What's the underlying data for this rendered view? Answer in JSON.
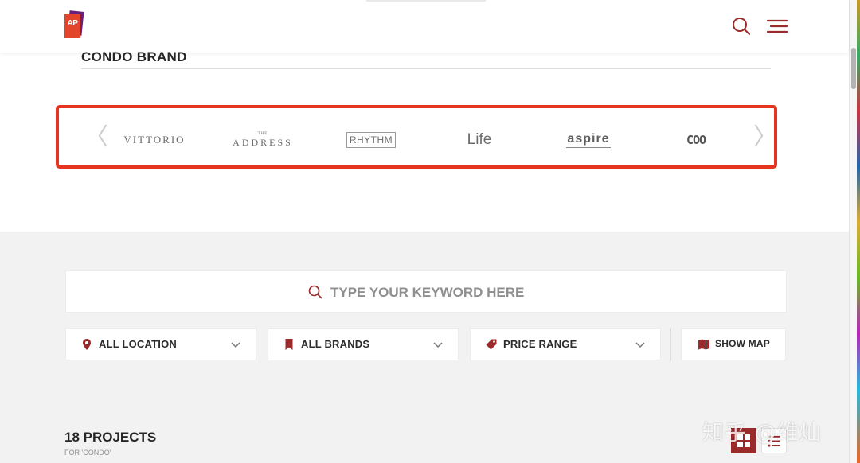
{
  "header": {
    "logo_text": "AP",
    "search_icon": "search-icon",
    "menu_icon": "menu-icon"
  },
  "section": {
    "title": "CONDO BRAND"
  },
  "brands": {
    "items": [
      "VITTORIO",
      "THE ADDRESS",
      "RHYTHM",
      "Life",
      "aspire",
      "COO"
    ],
    "address_small": "THE",
    "address_big": "ADDRESS",
    "prev_glyph": "〈",
    "next_glyph": "〉"
  },
  "search": {
    "placeholder": "TYPE YOUR KEYWORD HERE"
  },
  "filters": {
    "location": "ALL LOCATION",
    "brands": "ALL BRANDS",
    "price": "PRICE RANGE",
    "map": "SHOW MAP"
  },
  "results": {
    "count": "18 PROJECTS",
    "sub": "FOR 'CONDO'"
  },
  "watermark": "知乎 @维灿",
  "colors": {
    "accent": "#9b2a2a",
    "highlight": "#e5341f",
    "grey_bg": "#f2f2f2"
  }
}
